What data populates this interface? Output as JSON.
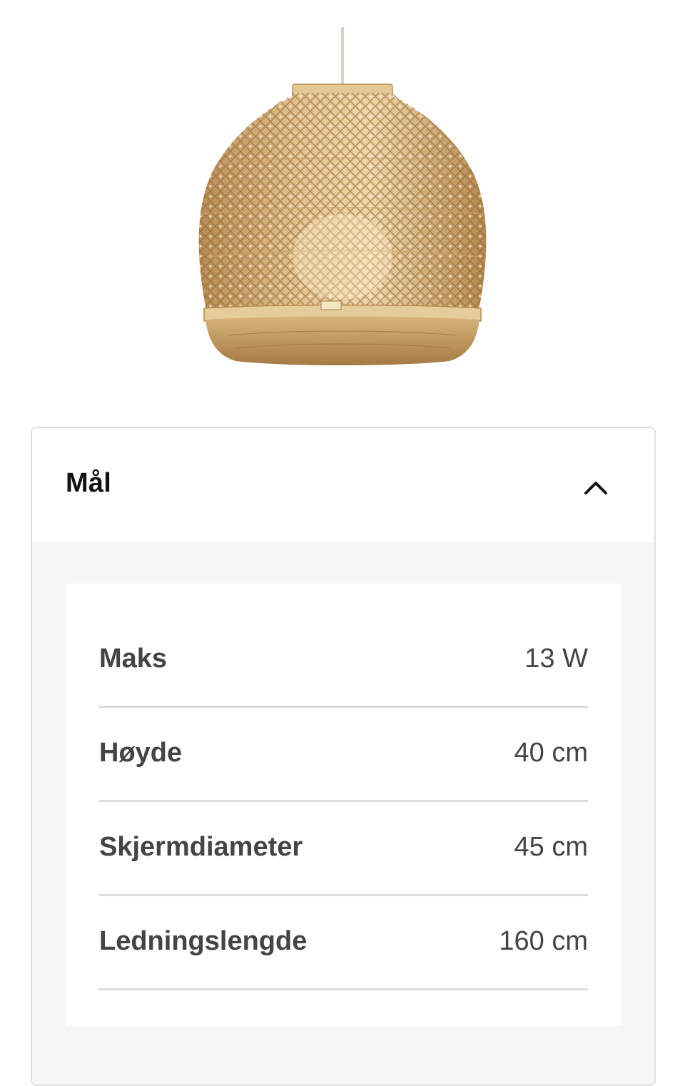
{
  "product": {
    "image_alt": "Bamboo pendant lamp shade",
    "image_icon": "pendant-lamp-image"
  },
  "accordion": {
    "title": "Mål",
    "expanded": true,
    "toggle_icon": "chevron-up-icon"
  },
  "specs": [
    {
      "label": "Maks",
      "value": "13 W"
    },
    {
      "label": "Høyde",
      "value": "40 cm"
    },
    {
      "label": "Skjermdiameter",
      "value": "45 cm"
    },
    {
      "label": "Ledningslengde",
      "value": "160 cm"
    }
  ],
  "colors": {
    "text_primary": "#111111",
    "text_secondary": "#444444",
    "divider": "#dcdcdc",
    "panel_background": "#f5f5f5",
    "bamboo": "#d8b57e"
  }
}
